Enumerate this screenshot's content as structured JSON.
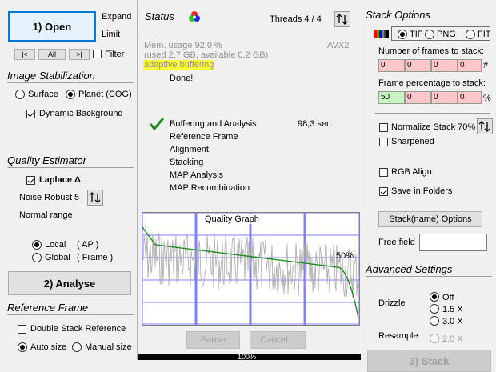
{
  "left": {
    "open_button": "1) Open",
    "expand_label": "Expand",
    "limit_label": "Limit",
    "nav_first": "|<",
    "nav_all": "All",
    "nav_last": ">|",
    "filter_label": "Filter",
    "stabilization_title": "Image Stabilization",
    "surface_label": "Surface",
    "planet_label": "Planet (COG)",
    "dynamic_bg_label": "Dynamic Background",
    "quality_title": "Quality Estimator",
    "laplace_label": "Laplace Δ",
    "noise_robust_label": "Noise Robust",
    "noise_robust_value": "5",
    "normal_range_label": "Normal range",
    "local_label": "Local",
    "local_ap": "( AP )",
    "global_label": "Global",
    "global_frame": "( Frame )",
    "analyse_button": "2) Analyse",
    "reference_title": "Reference Frame",
    "double_stack_label": "Double Stack Reference",
    "auto_size_label": "Auto size",
    "manual_size_label": "Manual size"
  },
  "status": {
    "title": "Status",
    "threads": "Threads 4 / 4",
    "mem_line1": "Mem. usage 92,0 %",
    "mem_line2": "(used 2,7 GB, available 0,2 GB)",
    "avx": "AVX2",
    "adaptive": "adaptive buffering",
    "done": "Done!",
    "steps": [
      {
        "label": "Buffering and Analysis",
        "time": "98,3 sec."
      },
      {
        "label": "Reference Frame",
        "time": ""
      },
      {
        "label": "Alignment",
        "time": ""
      },
      {
        "label": "Stacking",
        "time": ""
      },
      {
        "label": "MAP Analysis",
        "time": ""
      },
      {
        "label": "MAP Recombination",
        "time": ""
      }
    ],
    "graph_title": "Quality Graph",
    "graph_percent": "50%",
    "pause_button": "Pause",
    "cancel_button": "Cancel...",
    "progress_text": "100%",
    "progress_value": 100
  },
  "right": {
    "stack_title": "Stack Options",
    "tif_label": "TIF",
    "png_label": "PNG",
    "fit_label": "FIT",
    "frames_label": "Number of frames to stack:",
    "frames_values": [
      "0",
      "0",
      "0",
      "0"
    ],
    "frames_unit": "#",
    "percent_label": "Frame percentage to stack:",
    "percent_values": [
      "50",
      "0",
      "0",
      "0"
    ],
    "percent_unit": "%",
    "normalize_label": "Normalize Stack 70%",
    "sharpened_label": "Sharpened",
    "rgb_align_label": "RGB Align",
    "save_folders_label": "Save in Folders",
    "stackname_button": "Stack(name) Options",
    "free_field_label": "Free field",
    "free_field_value": "",
    "advanced_title": "Advanced Settings",
    "drizzle_label": "Drizzle",
    "drizzle_off": "Off",
    "drizzle_15": "1.5 X",
    "drizzle_30": "3.0 X",
    "resample_label": "Resample",
    "resample_20": "2.0 X",
    "stack_button": "3) Stack"
  },
  "colors": {
    "focus_blue": "#0078d7",
    "adaptive_bg": "#ffff33",
    "field_red": "#ffc7c7",
    "field_green": "#c7f5c0",
    "graph_curve": "#1e8c1e",
    "graph_trace": "#aaaaaa",
    "graph_grid": "#8080ff",
    "progress_bar": "#000000"
  }
}
